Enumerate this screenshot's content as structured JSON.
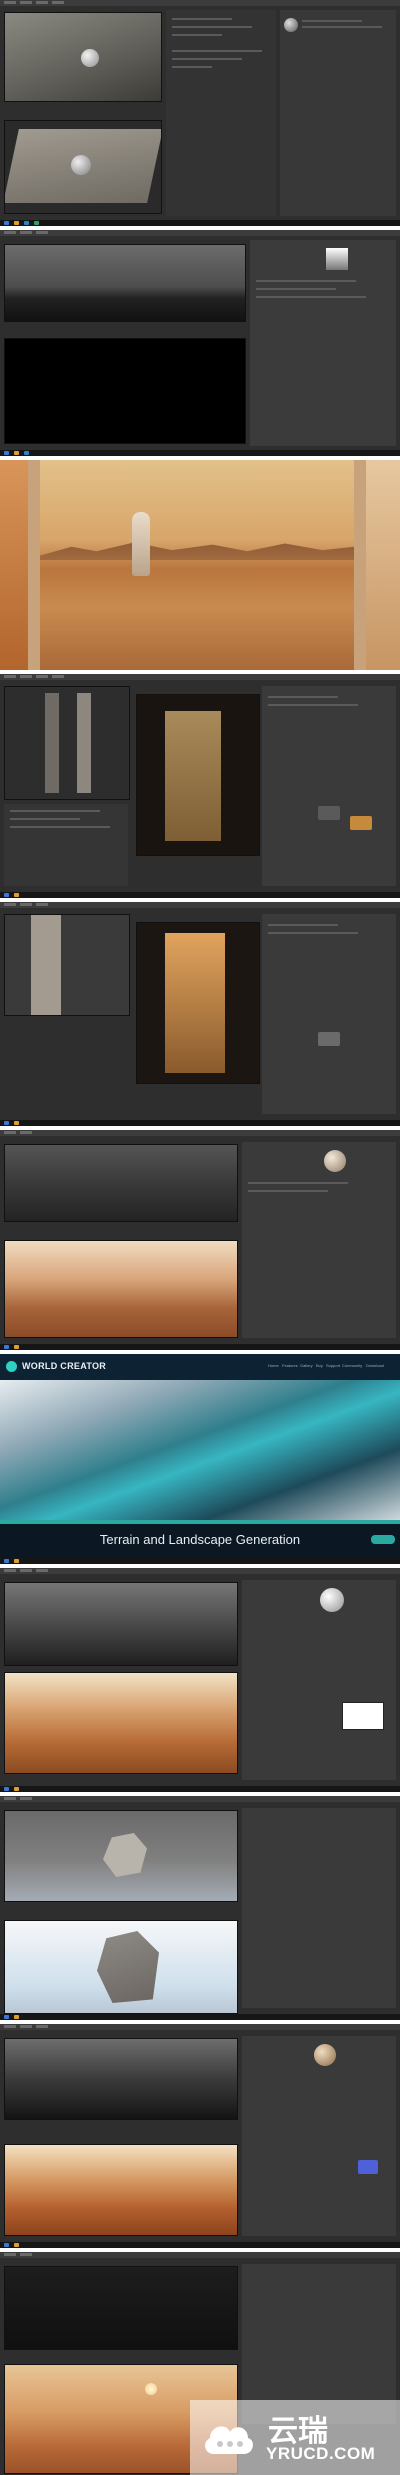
{
  "watermark": {
    "brand_cn": "云瑞",
    "brand_en": "YRUCD.COM",
    "icon": "cloud-icon"
  },
  "website": {
    "title": "WORLD CREATOR",
    "heading": "Terrain and Landscape Generation",
    "nav": [
      "Home",
      "Features",
      "Gallery",
      "Buy",
      "Support",
      "Community",
      "Download"
    ],
    "logo_icon": "world-creator-logo-icon",
    "accent": "#2fd0c4"
  },
  "panels": [
    {
      "name": "rock-sphere-ground-scene",
      "app_icon": "cinema4d-icon"
    },
    {
      "name": "dark-horizon-viewport",
      "app_icon": "cinema4d-icon"
    },
    {
      "name": "astronaut-mars-render"
    },
    {
      "name": "corridor-walls-scene",
      "app_icon": "cinema4d-icon"
    },
    {
      "name": "corridor-light-scene",
      "app_icon": "cinema4d-icon"
    },
    {
      "name": "rocky-terrain-scene",
      "app_icon": "cinema4d-icon"
    },
    {
      "name": "world-creator-site"
    },
    {
      "name": "terrain-render-scene",
      "app_icon": "cinema4d-icon"
    },
    {
      "name": "rock-model-scene",
      "app_icon": "cinema4d-icon"
    },
    {
      "name": "dunes-scene",
      "app_icon": "cinema4d-icon"
    },
    {
      "name": "sunset-mars-scene",
      "app_icon": "cinema4d-icon"
    }
  ],
  "colors": {
    "ui_dark": "#2e2e2e",
    "mars_orange": "#c9773a",
    "sky_warm": "#e6b574",
    "taskbar": "#161616"
  }
}
